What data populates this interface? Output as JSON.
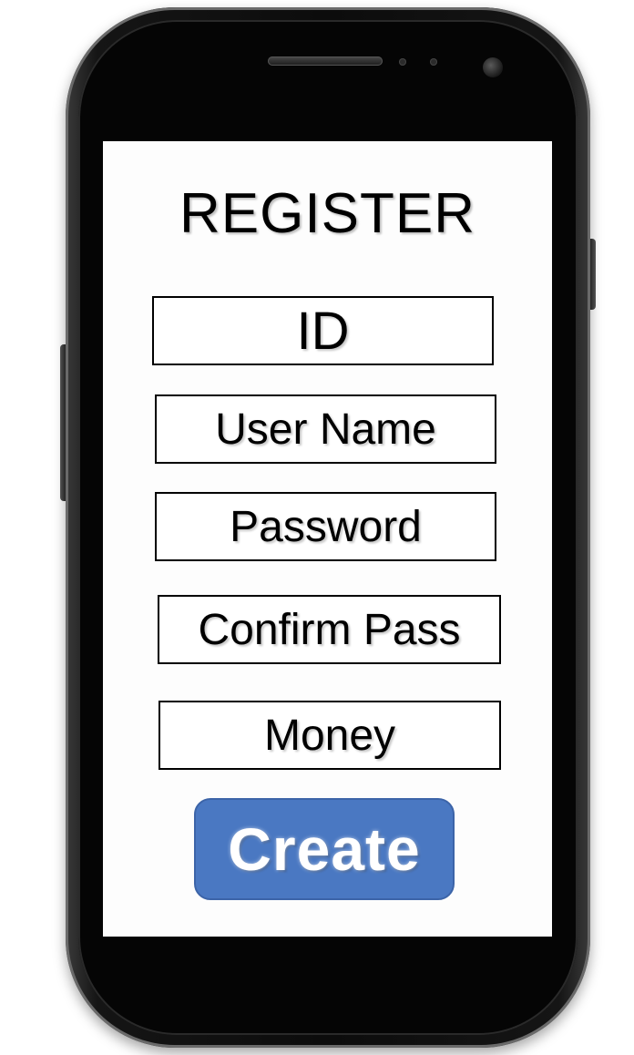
{
  "screen": {
    "title": "REGISTER",
    "fields": [
      {
        "label": "ID"
      },
      {
        "label": "User Name"
      },
      {
        "label": "Password"
      },
      {
        "label": "Confirm Pass"
      },
      {
        "label": "Money"
      }
    ],
    "create_label": "Create"
  },
  "colors": {
    "button_fill": "#4a78c2",
    "button_text": "#ffffff",
    "phone_body": "#0c0c0c",
    "screen_bg": "#fdfdfd"
  },
  "icons": {
    "speaker": "earpiece-speaker-icon",
    "camera": "front-camera-icon"
  }
}
